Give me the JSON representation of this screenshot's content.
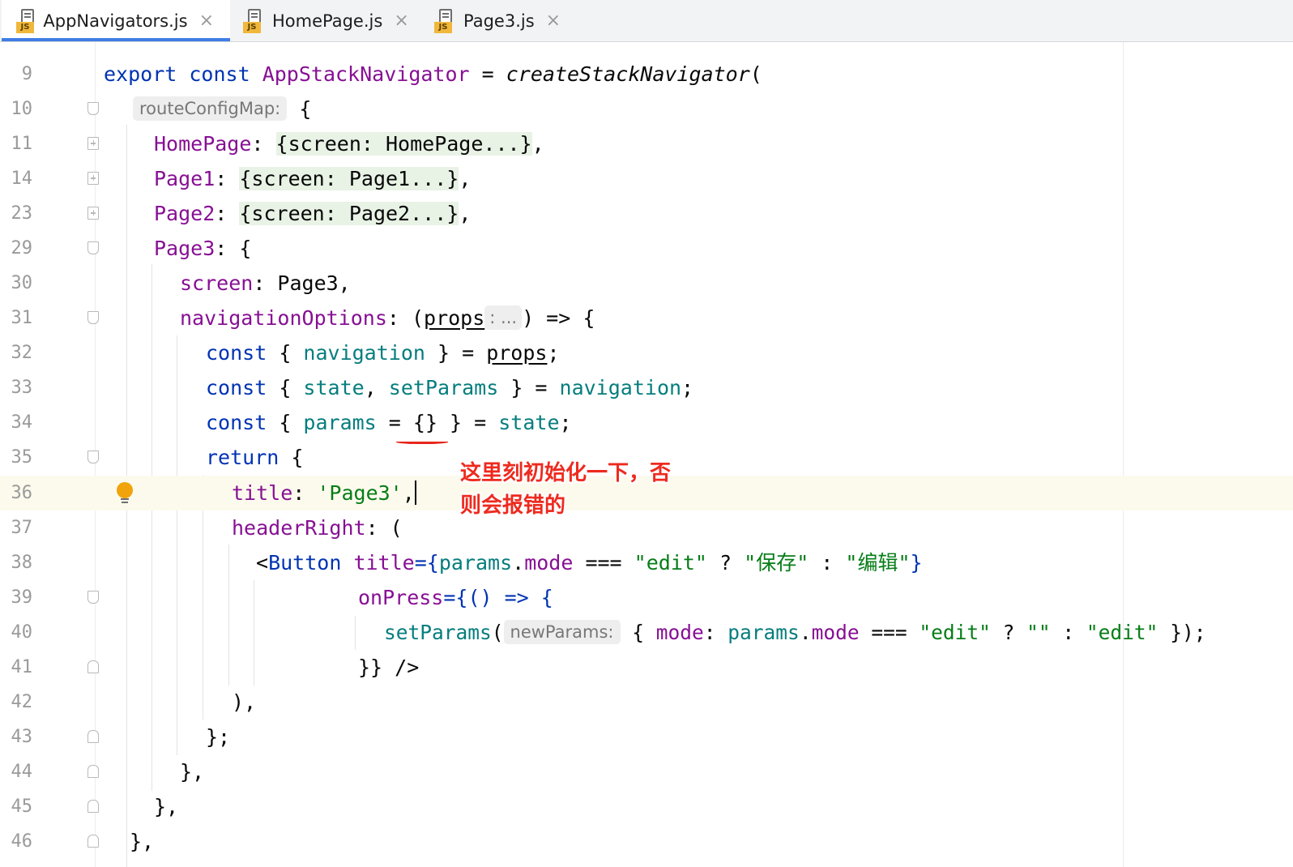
{
  "tabs": [
    {
      "label": "AppNavigators.js",
      "icon": "js-file-icon",
      "active": true
    },
    {
      "label": "HomePage.js",
      "icon": "js-file-icon",
      "active": false
    },
    {
      "label": "Page3.js",
      "icon": "js-file-icon",
      "active": false
    }
  ],
  "file_badge": "JS",
  "close_glyph": "×",
  "editor": {
    "current_line": "36",
    "line_numbers": [
      "9",
      "10",
      "11",
      "14",
      "23",
      "29",
      "30",
      "31",
      "32",
      "33",
      "34",
      "35",
      "36",
      "37",
      "38",
      "39",
      "40",
      "41",
      "42",
      "43",
      "44",
      "45",
      "46"
    ],
    "code": {
      "l9": {
        "export": "export",
        "const": "const",
        "name": "AppStackNavigator",
        "eq": " = ",
        "fn": "createStackNavigator",
        "paren": "("
      },
      "l10": {
        "hint": "routeConfigMap:",
        "brace": " {"
      },
      "l11": {
        "key": "HomePage",
        "colon": ": ",
        "folded": "{screen: HomePage...}",
        "tail": ","
      },
      "l14": {
        "key": "Page1",
        "colon": ": ",
        "folded": "{screen: Page1...}",
        "tail": ","
      },
      "l23": {
        "key": "Page2",
        "colon": ": ",
        "folded": "{screen: Page2...}",
        "tail": ","
      },
      "l29": {
        "key": "Page3",
        "rest": ": {"
      },
      "l30": {
        "key": "screen",
        "rest": ": Page3,"
      },
      "l31": {
        "key": "navigationOptions",
        "open": ": (",
        "param": "props",
        "hint": ": ...",
        "rest": ") => {"
      },
      "l32": {
        "const": "const",
        "open": " { ",
        "v1": "navigation",
        "mid": " } = ",
        "ref": "props",
        "end": ";"
      },
      "l33": {
        "const": "const",
        "open": " { ",
        "v1": "state",
        "comma": ", ",
        "v2": "setParams",
        "mid": " } = ",
        "v3": "navigation",
        "end": ";"
      },
      "l34": {
        "const": "const",
        "open": " { ",
        "v1": "params",
        "mid": " = {} } = ",
        "v2": "state",
        "end": ";"
      },
      "l35": {
        "kw": "return",
        "rest": " {"
      },
      "l36": {
        "key": "title",
        "colon": ": ",
        "str": "'Page3'",
        "end": ","
      },
      "l37": {
        "key": "headerRight",
        "rest": ": ("
      },
      "l38": {
        "lt": "<",
        "tag": "Button",
        "sp": " ",
        "attr": "title",
        "eq": "={",
        "v1": "params",
        "dot": ".",
        "p1": "mode",
        "op": " === ",
        "s1": "\"edit\"",
        "q": " ? ",
        "s2": "\"保存\"",
        "c": " : ",
        "s3": "\"编辑\"",
        "end": "}"
      },
      "l39": {
        "attr": "onPress",
        "rest": "={() => {"
      },
      "l40": {
        "fn": "setParams",
        "open": "(",
        "hint": "newParams:",
        "b": " { ",
        "p1": "mode",
        "colon": ": ",
        "v1": "params",
        "dot": ".",
        "p2": "mode",
        "op": " === ",
        "s1": "\"edit\"",
        "q": " ? ",
        "s2": "\"\"",
        "c": " : ",
        "s3": "\"edit\"",
        "end": " });"
      },
      "l41": {
        "text": "}} />"
      },
      "l42": {
        "text": "),"
      },
      "l43": {
        "text": "};"
      },
      "l44": {
        "text": "},"
      },
      "l45": {
        "text": "},"
      },
      "l46": {
        "text": "},"
      }
    }
  },
  "annotation": {
    "line1": "这里刻初始化一下，否",
    "line2": "则会报错的",
    "color": "#ee2a1f"
  },
  "colors": {
    "keyword": "#0033b3",
    "property": "#871094",
    "variable": "#067d7e",
    "string": "#067d17",
    "tab_accent": "#3f7de5",
    "current_line_bg": "#fcfaed"
  }
}
